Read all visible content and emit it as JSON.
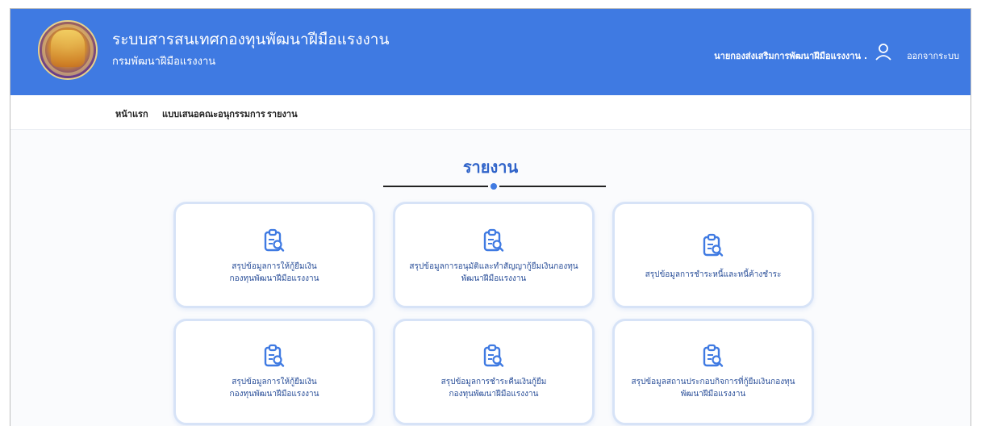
{
  "header": {
    "title": "ระบบสารสนเทศกองทุนพัฒนาฝีมือแรงงาน",
    "subtitle": "กรมพัฒนาฝีมือแรงงาน",
    "user_name": "นายกองส่งเสริมการพัฒนาฝีมือแรงงาน .",
    "logout_label": "ออกจากระบบ"
  },
  "nav": {
    "items": [
      {
        "label": "หน้าแรก"
      },
      {
        "label": "แบบเสนอคณะอนุกรรมการ"
      },
      {
        "label": "รายงาน"
      }
    ]
  },
  "main": {
    "heading": "รายงาน",
    "cards": [
      {
        "line1": "สรุปข้อมูลการให้กู้ยืมเงิน",
        "line2": "กองทุนพัฒนาฝีมือแรงงาน",
        "icon": "clipboard-search-icon"
      },
      {
        "line1": "สรุปข้อมูลการอนุมัติและทำสัญญากู้ยืมเงินกองทุน",
        "line2": "พัฒนาฝีมือแรงงาน",
        "icon": "clipboard-search-icon"
      },
      {
        "line1": "สรุปข้อมูลการชำระหนี้และหนี้ค้างชำระ",
        "line2": "",
        "icon": "clipboard-search-icon"
      },
      {
        "line1": "สรุปข้อมูลการให้กู้ยืมเงิน",
        "line2": "กองทุนพัฒนาฝีมือแรงงาน",
        "icon": "clipboard-search-icon"
      },
      {
        "line1": "สรุปข้อมูลการชำระคืนเงินกู้ยืม",
        "line2": "กองทุนพัฒนาฝีมือแรงงาน",
        "icon": "clipboard-search-icon"
      },
      {
        "line1": "สรุปข้อมูลสถานประกอบกิจการที่กู้ยืมเงินกองทุน",
        "line2": "พัฒนาฝีมือแรงงาน",
        "icon": "clipboard-search-icon"
      }
    ]
  },
  "colors": {
    "header_bg": "#3f7ae2",
    "accent": "#2f63c9",
    "card_border": "#d7e3f7"
  }
}
